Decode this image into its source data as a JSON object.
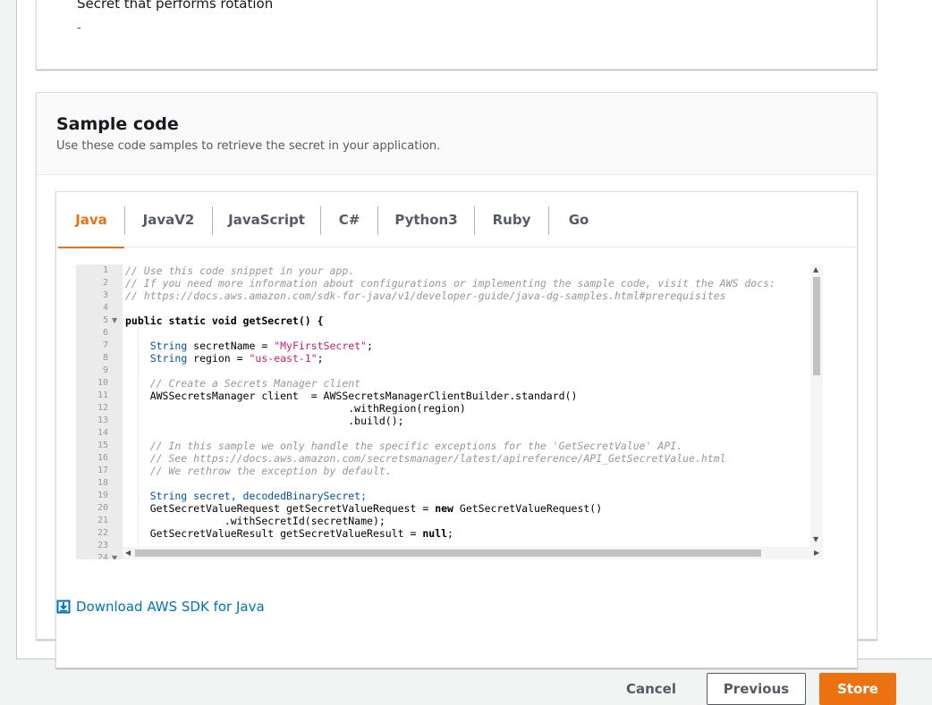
{
  "top_panel": {
    "label": "Secret that performs rotation",
    "value": "-"
  },
  "sample_code": {
    "title": "Sample code",
    "description": "Use these code samples to retrieve the secret in your application."
  },
  "tabs": [
    {
      "label": "Java",
      "active": true
    },
    {
      "label": "JavaV2",
      "active": false
    },
    {
      "label": "JavaScript",
      "active": false
    },
    {
      "label": "C#",
      "active": false
    },
    {
      "label": "Python3",
      "active": false
    },
    {
      "label": "Ruby",
      "active": false
    },
    {
      "label": "Go",
      "active": false
    }
  ],
  "editor": {
    "line_numbers": [
      "1",
      "2",
      "3",
      "4",
      "5",
      "6",
      "7",
      "8",
      "9",
      "10",
      "11",
      "12",
      "13",
      "14",
      "15",
      "16",
      "17",
      "18",
      "19",
      "20",
      "21",
      "22",
      "23",
      "24"
    ],
    "lines": [
      "// Use this code snippet in your app.",
      "// If you need more information about configurations or implementing the sample code, visit the AWS docs:",
      "// https://docs.aws.amazon.com/sdk-for-java/v1/developer-guide/java-dg-samples.html#prerequisites",
      "",
      "public static void getSecret() {",
      "",
      "    String secretName = \"MyFirstSecret\";",
      "    String region = \"us-east-1\";",
      "",
      "    // Create a Secrets Manager client",
      "    AWSSecretsManager client  = AWSSecretsManagerClientBuilder.standard()",
      "                                    .withRegion(region)",
      "                                    .build();",
      "",
      "    // In this sample we only handle the specific exceptions for the 'GetSecretValue' API.",
      "    // See https://docs.aws.amazon.com/secretsmanager/latest/apireference/API_GetSecretValue.html",
      "    // We rethrow the exception by default.",
      "",
      "    String secret, decodedBinarySecret;",
      "    GetSecretValueRequest getSecretValueRequest = new GetSecretValueRequest()",
      "                .withSecretId(secretName);",
      "    GetSecretValueResult getSecretValueResult = null;",
      ""
    ]
  },
  "download_link": "Download AWS SDK for Java",
  "footer": {
    "cancel": "Cancel",
    "previous": "Previous",
    "store": "Store"
  },
  "colors": {
    "accent": "#ec7211",
    "link": "#0073bb",
    "string": "#d01a6e",
    "type": "#0451a5",
    "comment": "#969896"
  },
  "icons": [
    "download-icon",
    "fold-arrow-icon",
    "scroll-up-icon",
    "scroll-down-icon",
    "scroll-left-icon",
    "scroll-right-icon"
  ]
}
